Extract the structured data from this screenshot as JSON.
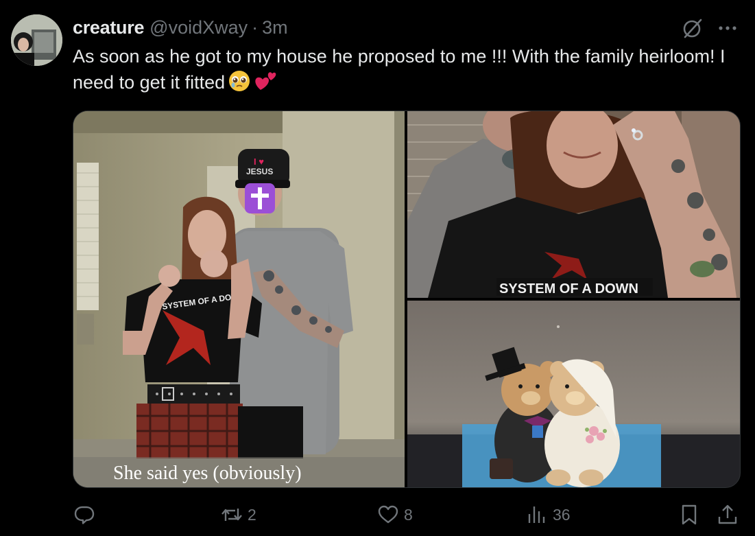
{
  "author": {
    "display_name": "creature",
    "handle": "@voidXway",
    "separator": "·",
    "time": "3m"
  },
  "post": {
    "text": "As soon as he got to my house he proposed to me !!! With the family heirloom! I need to get it fitted",
    "emojis": [
      "pleading-face-icon",
      "two-hearts-icon"
    ]
  },
  "media": {
    "photos": [
      {
        "name": "couple-photo",
        "caption": "She said yes (obviously)",
        "shirt_text": "SYSTEM OF A DOWN",
        "hat_text": "I ♥ JESUS"
      },
      {
        "name": "ring-hand-photo",
        "shirt_text": "SYSTEM OF A DOWN"
      },
      {
        "name": "bear-figurine-photo"
      }
    ]
  },
  "actions": {
    "reply": {
      "icon": "reply-icon",
      "count": ""
    },
    "repost": {
      "icon": "repost-icon",
      "count": "2"
    },
    "like": {
      "icon": "heart-icon",
      "count": "8"
    },
    "views": {
      "icon": "views-icon",
      "count": "36"
    },
    "bookmark": {
      "icon": "bookmark-icon"
    },
    "share": {
      "icon": "share-icon"
    }
  },
  "colors": {
    "background": "#000000",
    "text_primary": "#e7e9ea",
    "text_secondary": "#71767b",
    "border": "#2f3336"
  }
}
